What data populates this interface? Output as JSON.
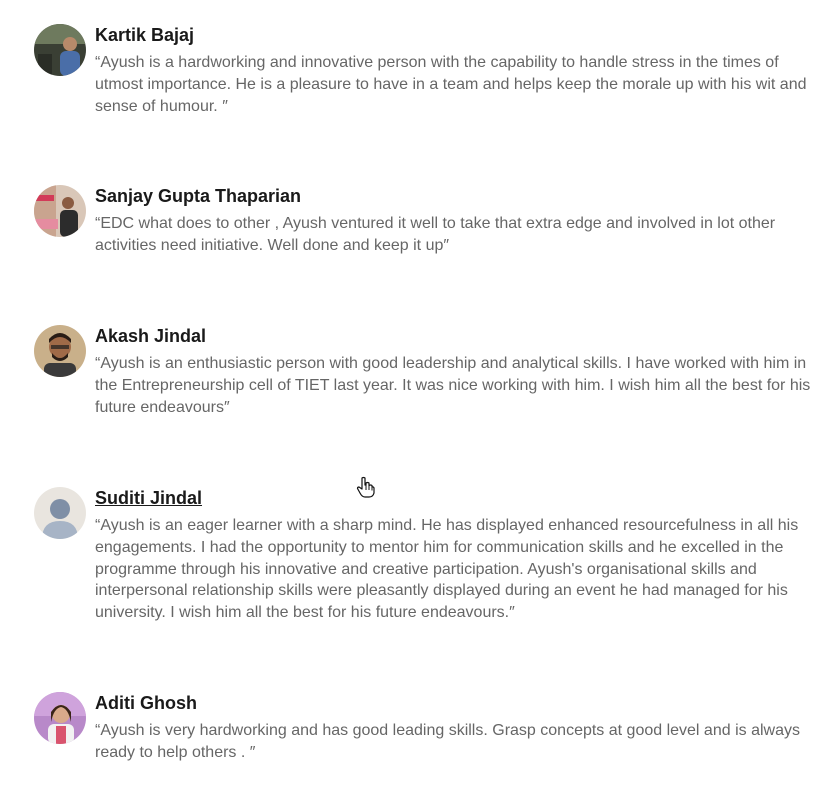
{
  "recommendations": [
    {
      "name": "Kartik Bajaj",
      "avatar_icon": "profile-photo-icon",
      "quote": "“Ayush is a hardworking and innovative person with the capability to handle stress in the times of utmost importance. He is a pleasure to have in a team and helps keep the morale up with his wit and sense of humour. ″"
    },
    {
      "name": "Sanjay Gupta Thaparian",
      "avatar_icon": "profile-photo-icon",
      "quote": "“EDC what does to other , Ayush ventured it well to take that extra edge and involved in lot other activities need initiative. Well done and keep it up″"
    },
    {
      "name": "Akash Jindal",
      "avatar_icon": "profile-photo-icon",
      "quote": "“Ayush is an enthusiastic person with good leadership and analytical skills. I have worked with him in the Entrepreneurship cell of TIET last year. It was nice working with him. I wish him all the best for his future endeavours″"
    },
    {
      "name": "Suditi Jindal",
      "avatar_icon": "default-avatar-icon",
      "quote": "“Ayush is an eager learner with a sharp mind. He has displayed enhanced resourcefulness in all his engagements. I had the opportunity to mentor him for communication skills and he excelled in the programme through his innovative and creative participation. Ayush's organisational skills and interpersonal relationship skills were pleasantly displayed during an event he had managed for his university. I wish him all the best for his future endeavours.″"
    },
    {
      "name": "Aditi Ghosh",
      "avatar_icon": "profile-photo-icon",
      "quote": "“Ayush is very hardworking and has good leading skills. Grasp concepts at good level and is always ready to help others . ″"
    }
  ],
  "colors": {
    "name_text": "#1a1a1a",
    "quote_text": "#666666",
    "background": "#ffffff"
  },
  "cursor_icon": "hand-pointer-cursor-icon"
}
